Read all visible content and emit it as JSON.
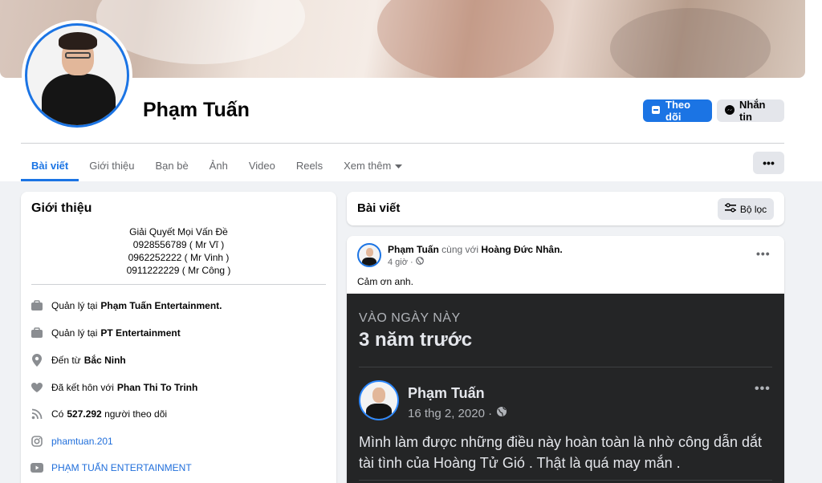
{
  "profile": {
    "name": "Phạm Tuấn",
    "follow_label": "Theo dõi",
    "message_label": "Nhắn tin"
  },
  "tabs": [
    {
      "label": "Bài viết",
      "active": true
    },
    {
      "label": "Giới thiệu"
    },
    {
      "label": "Bạn bè"
    },
    {
      "label": "Ảnh"
    },
    {
      "label": "Video"
    },
    {
      "label": "Reels"
    },
    {
      "label": "Xem thêm"
    }
  ],
  "more_label": "•••",
  "intro": {
    "title": "Giới thiệu",
    "bio": [
      "Giải Quyết Mọi Vấn Đề",
      "0928556789 ( Mr Vĩ )",
      "0962252222 ( Mr Vinh )",
      "0911222229 ( Mr Công )"
    ],
    "rows": [
      {
        "icon": "briefcase-icon",
        "prefix": "Quản lý tại",
        "value": "Phạm Tuấn Entertainment."
      },
      {
        "icon": "briefcase-icon",
        "prefix": "Quản lý tại",
        "value": "PT Entertainment"
      },
      {
        "icon": "location-pin-icon",
        "prefix": "Đến từ",
        "value": "Bắc Ninh"
      },
      {
        "icon": "heart-icon",
        "prefix": "Đã kết hôn với",
        "value": "Phan Thi To Trinh"
      },
      {
        "icon": "rss-icon",
        "prefix": "Có",
        "value": "527.292",
        "suffix": "người theo dõi"
      },
      {
        "icon": "instagram-icon",
        "link": "phamtuan.201"
      },
      {
        "icon": "youtube-icon",
        "link": "PHẠM TUẤN ENTERTAINMENT"
      }
    ]
  },
  "posts": {
    "title": "Bài viết",
    "filter_label": "Bộ lọc"
  },
  "post": {
    "author": "Phạm Tuấn",
    "with_text": "cùng với",
    "tagged": "Hoàng Đức Nhân.",
    "time": "4 giờ ·",
    "text": "Cảm ơn anh.",
    "dots": "•••",
    "memory": {
      "label": "VÀO NGÀY NÀY",
      "when": "3 năm trước",
      "author": "Phạm Tuấn",
      "date": "16 thg 2, 2020 ·",
      "text": "Mình làm được những điều này hoàn toàn là nhờ công dẫn dắt tài tình của Hoàng Tử Gió . Thật là quá may mắn ."
    }
  },
  "colors": {
    "accent": "#1b74e4",
    "page_bg": "#f0f2f5",
    "memory_bg": "#242526"
  }
}
